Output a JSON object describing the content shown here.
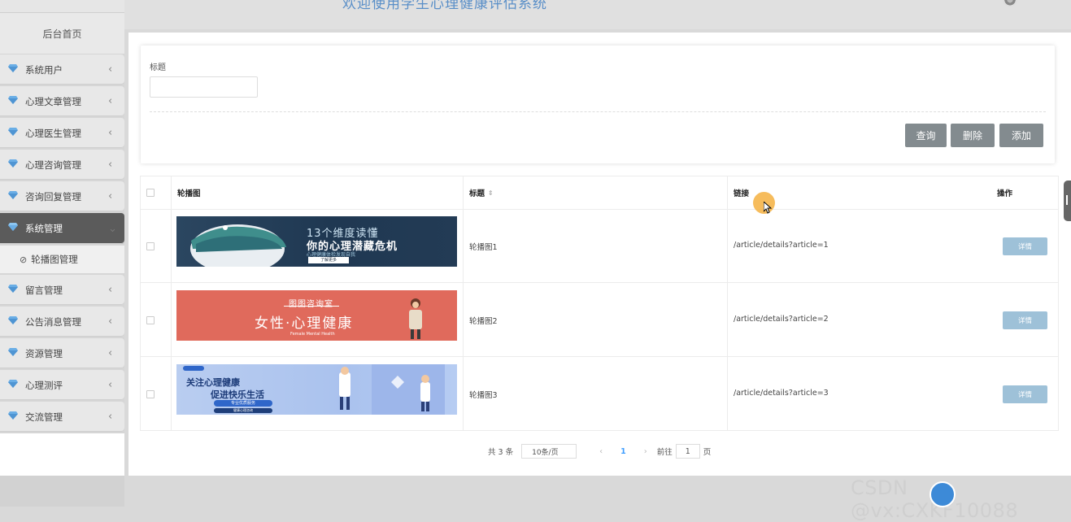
{
  "header": {
    "title": "欢迎使用学生心理健康评估系统"
  },
  "sidebar": {
    "home": "后台首页",
    "items": [
      {
        "label": "系统用户"
      },
      {
        "label": "心理文章管理"
      },
      {
        "label": "心理医生管理"
      },
      {
        "label": "心理咨询管理"
      },
      {
        "label": "咨询回复管理"
      },
      {
        "label": "系统管理",
        "active": true
      },
      {
        "label": "留言管理"
      },
      {
        "label": "公告消息管理"
      },
      {
        "label": "资源管理"
      },
      {
        "label": "心理测评"
      },
      {
        "label": "交流管理"
      }
    ],
    "sub_item": "轮播图管理"
  },
  "search": {
    "label": "标题",
    "value": "",
    "buttons": {
      "query": "查询",
      "delete": "删除",
      "add": "添加"
    }
  },
  "table": {
    "headers": {
      "image": "轮播图",
      "title": "标题",
      "link": "链接",
      "action": "操作"
    },
    "rows": [
      {
        "title": "轮播图1",
        "link": "/article/details?article=1",
        "action": "详情",
        "banner": {
          "line1": "13个维度读懂",
          "line2": "你的心理潜藏危机",
          "line3": "心理健康体检发现自我",
          "button": "了解更多"
        }
      },
      {
        "title": "轮播图2",
        "link": "/article/details?article=2",
        "action": "详情",
        "banner": {
          "line1": "图图咨询室",
          "line2": "女性·心理健康",
          "line3": "Female Mental Health"
        }
      },
      {
        "title": "轮播图3",
        "link": "/article/details?article=3",
        "action": "详情",
        "banner": {
          "line1": "关注心理健康",
          "line2": "促进快乐生活",
          "line3": "专业优质服务",
          "button": "健康心理咨询"
        }
      }
    ]
  },
  "pagination": {
    "total": "共 3 条",
    "page_size": "10条/页",
    "prev": "‹",
    "current": "1",
    "next": "›",
    "goto_prefix": "前往",
    "goto_value": "1",
    "goto_suffix": "页"
  },
  "watermark": "CSDN @vx:CXKF10088",
  "colors": {
    "accent": "#409eff",
    "button_grey": "#838b8f",
    "detail_button": "#9ec1d8",
    "title_blue": "#5a8fc8",
    "menu_active": "#5b5b5b"
  }
}
